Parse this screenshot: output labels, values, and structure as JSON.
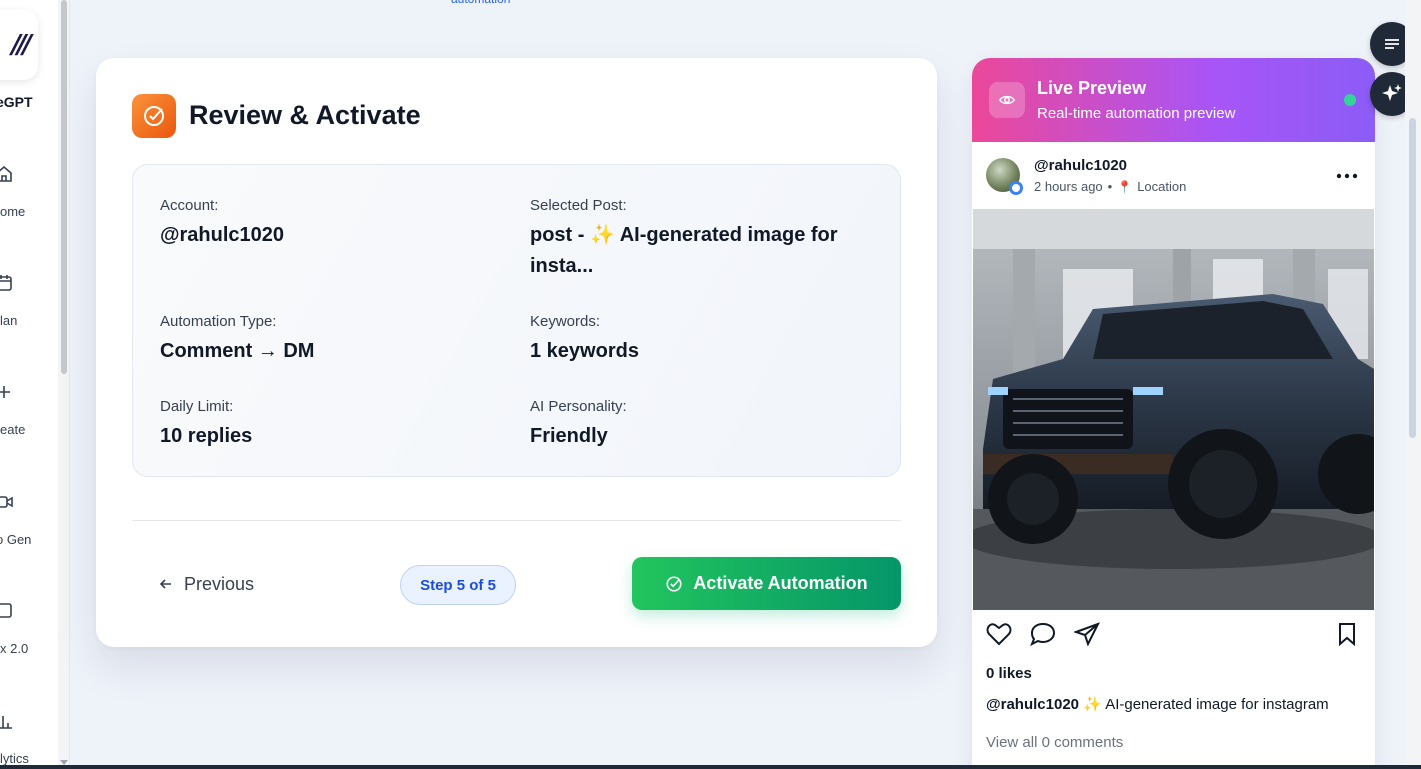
{
  "sidebar": {
    "brand": "eGPT",
    "items": [
      {
        "label": "ome",
        "icon": "home-icon"
      },
      {
        "label": "lan",
        "icon": "calendar-icon"
      },
      {
        "label": "eate",
        "icon": "plus-icon"
      },
      {
        "label": "o Gen",
        "icon": "video-icon"
      },
      {
        "label": "x 2.0",
        "icon": "inbox-icon"
      },
      {
        "label": "lytics",
        "icon": "analytics-icon"
      }
    ]
  },
  "top_link": "automation",
  "review": {
    "title": "Review & Activate",
    "fields": {
      "account": {
        "label": "Account:",
        "value": "@rahulc1020"
      },
      "selected_post": {
        "label": "Selected Post:",
        "value_line1": "post - ✨ AI-generated image for",
        "value_line2": "insta..."
      },
      "automation_type": {
        "label": "Automation Type:",
        "value": "Comment → DM"
      },
      "keywords": {
        "label": "Keywords:",
        "value": "1 keywords"
      },
      "daily_limit": {
        "label": "Daily Limit:",
        "value": "10 replies"
      },
      "ai_personality": {
        "label": "AI Personality:",
        "value": "Friendly"
      }
    },
    "previous_label": "Previous",
    "step_label": "Step 5 of 5",
    "activate_label": "Activate Automation"
  },
  "preview": {
    "title": "Live Preview",
    "subtitle": "Real-time automation preview",
    "username": "@rahulc1020",
    "time": "2 hours ago",
    "separator": "•",
    "location_pin": "📍",
    "location": "Location",
    "likes": "0 likes",
    "caption_user": "@rahulc1020",
    "caption_text": "✨ AI-generated image for instagram",
    "view_comments": "View all 0 comments"
  },
  "colors": {
    "accent_green": "#22c55e",
    "accent_blue": "#1d4ed8",
    "header_pink": "#ec4899",
    "header_purple": "#8b5cf6",
    "title_orange": "#f97316"
  }
}
